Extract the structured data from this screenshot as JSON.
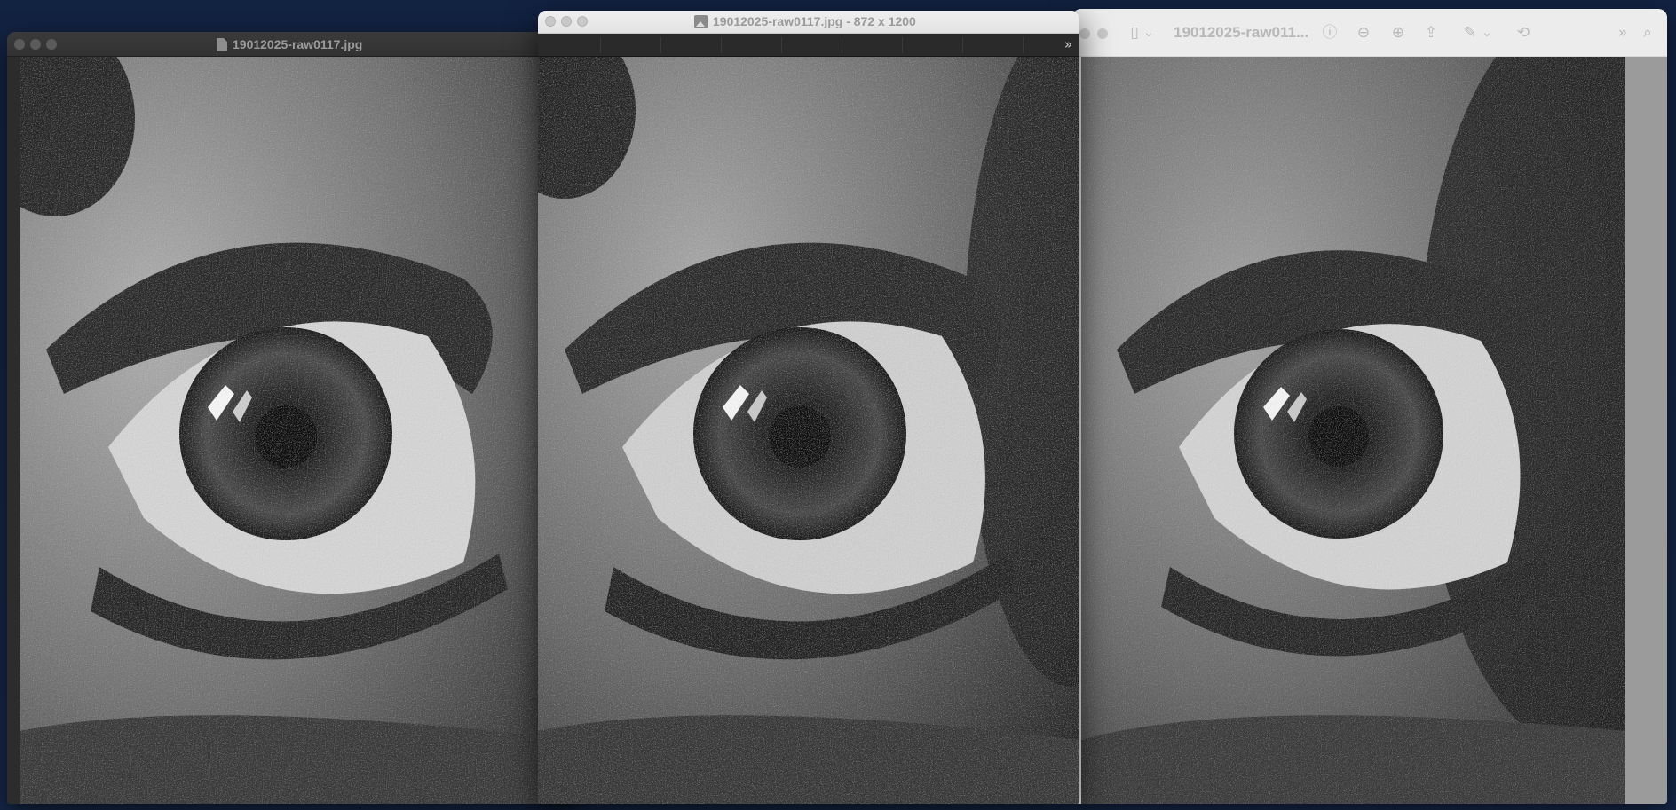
{
  "windows": {
    "quicklook": {
      "title": "19012025-raw0117.jpg",
      "doc_icon": "document-icon"
    },
    "front_viewer": {
      "title": "19012025-raw0117.jpg  - 872 x 1200",
      "image_icon": "image-icon",
      "overflow_icon": "chevron-double-right-icon",
      "overflow_glyph": "»"
    },
    "preview": {
      "title": "19012025-raw011...",
      "toolbar_icons": [
        {
          "name": "sidebar-toggle-icon",
          "glyph": "▯"
        },
        {
          "name": "chevron-down-icon",
          "glyph": "⌄"
        },
        {
          "name": "info-icon",
          "glyph": "ⓘ"
        },
        {
          "name": "zoom-out-icon",
          "glyph": "⊖"
        },
        {
          "name": "zoom-in-icon",
          "glyph": "⊕"
        },
        {
          "name": "share-icon",
          "glyph": "⇪"
        },
        {
          "name": "markup-pen-icon",
          "glyph": "✎"
        },
        {
          "name": "markup-chevron-icon",
          "glyph": "⌄"
        },
        {
          "name": "rotate-icon",
          "glyph": "⟲"
        },
        {
          "name": "more-toolbar-icon",
          "glyph": "»"
        },
        {
          "name": "search-icon",
          "glyph": "⌕"
        }
      ]
    }
  },
  "image": {
    "subject": "close-up eye photograph (grayscale, noisy)"
  },
  "colors": {
    "desktop": "#14233f",
    "light_chrome": "#ececec",
    "dark_chrome": "#2c2c2c"
  }
}
